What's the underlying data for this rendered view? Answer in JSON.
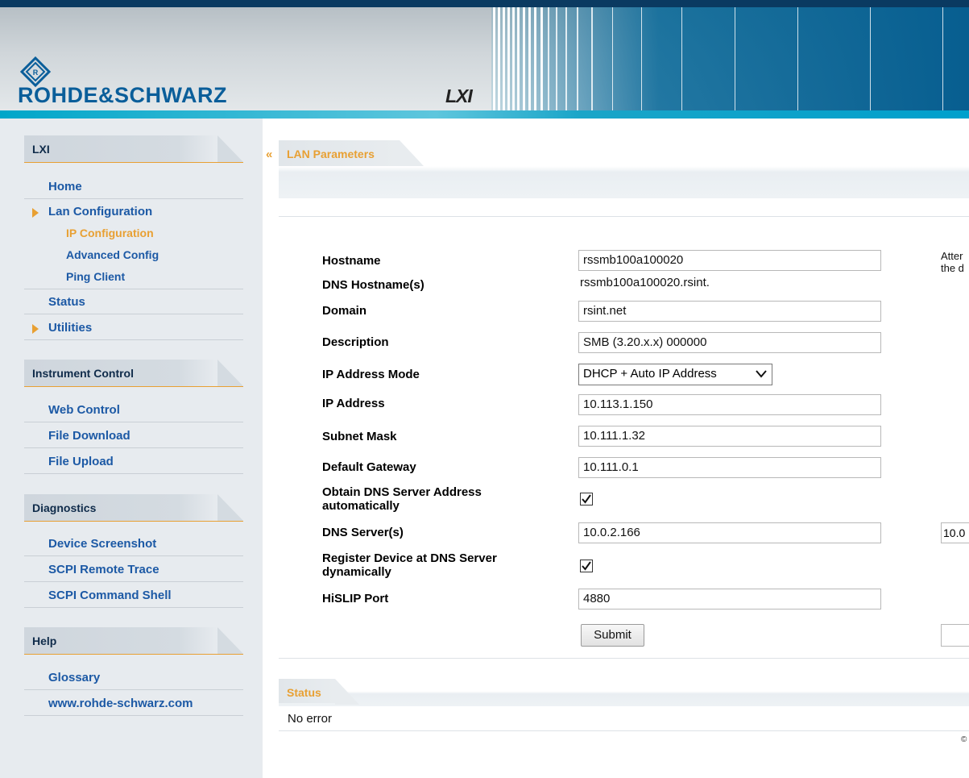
{
  "header": {
    "brand": "ROHDE&SCHWARZ",
    "lxi_logo": "LXI"
  },
  "sidebar": {
    "sections": [
      {
        "title": "LXI"
      },
      {
        "title": "Instrument Control"
      },
      {
        "title": "Diagnostics"
      },
      {
        "title": "Help"
      }
    ],
    "lxi_items": {
      "home": "Home",
      "lan_configuration": "Lan Configuration",
      "ip_configuration": "IP Configuration",
      "advanced_config": "Advanced Config",
      "ping_client": "Ping Client",
      "status": "Status",
      "utilities": "Utilities"
    },
    "instrument_items": {
      "web_control": "Web Control",
      "file_download": "File Download",
      "file_upload": "File Upload"
    },
    "diagnostics_items": {
      "device_screenshot": "Device Screenshot",
      "scpi_remote_trace": "SCPI Remote Trace",
      "scpi_command_shell": "SCPI Command Shell"
    },
    "help_items": {
      "glossary": "Glossary",
      "website": "www.rohde-schwarz.com"
    }
  },
  "main": {
    "collapse_icon": "«",
    "lan_panel_title": "LAN Parameters",
    "fields": {
      "hostname": {
        "label": "Hostname",
        "value": "rssmb100a100020"
      },
      "dns_hostnames": {
        "label": "DNS Hostname(s)",
        "value": "rssmb100a100020.rsint."
      },
      "domain": {
        "label": "Domain",
        "value": "rsint.net"
      },
      "description": {
        "label": "Description",
        "value": "SMB (3.20.x.x) 000000"
      },
      "ip_address_mode": {
        "label": "IP Address Mode",
        "value": "DHCP + Auto IP Address"
      },
      "ip_address": {
        "label": "IP Address",
        "value": "10.113.1.150"
      },
      "subnet_mask": {
        "label": "Subnet Mask",
        "value": "10.111.1.32"
      },
      "default_gateway": {
        "label": "Default Gateway",
        "value": "10.111.0.1"
      },
      "obtain_dns": {
        "label_line1": "Obtain DNS Server Address",
        "label_line2": "automatically",
        "checked": true
      },
      "dns_servers": {
        "label": "DNS Server(s)",
        "value": "10.0.2.166",
        "value2": "10.0"
      },
      "register_dns": {
        "label_line1": "Register Device at DNS Server",
        "label_line2": "dynamically",
        "checked": true
      },
      "hislip_port": {
        "label": "HiSLIP Port",
        "value": "4880"
      }
    },
    "submit_label": "Submit",
    "right_note_line1": "Atter",
    "right_note_line2": "the d",
    "status_panel_title": "Status",
    "status_text": "No error",
    "copyright": "©"
  },
  "colors": {
    "accent_orange": "#e8a033",
    "link_blue": "#1c59a5",
    "brand_blue": "#0a5e9a",
    "sidebar_bg": "#e7ebef"
  }
}
